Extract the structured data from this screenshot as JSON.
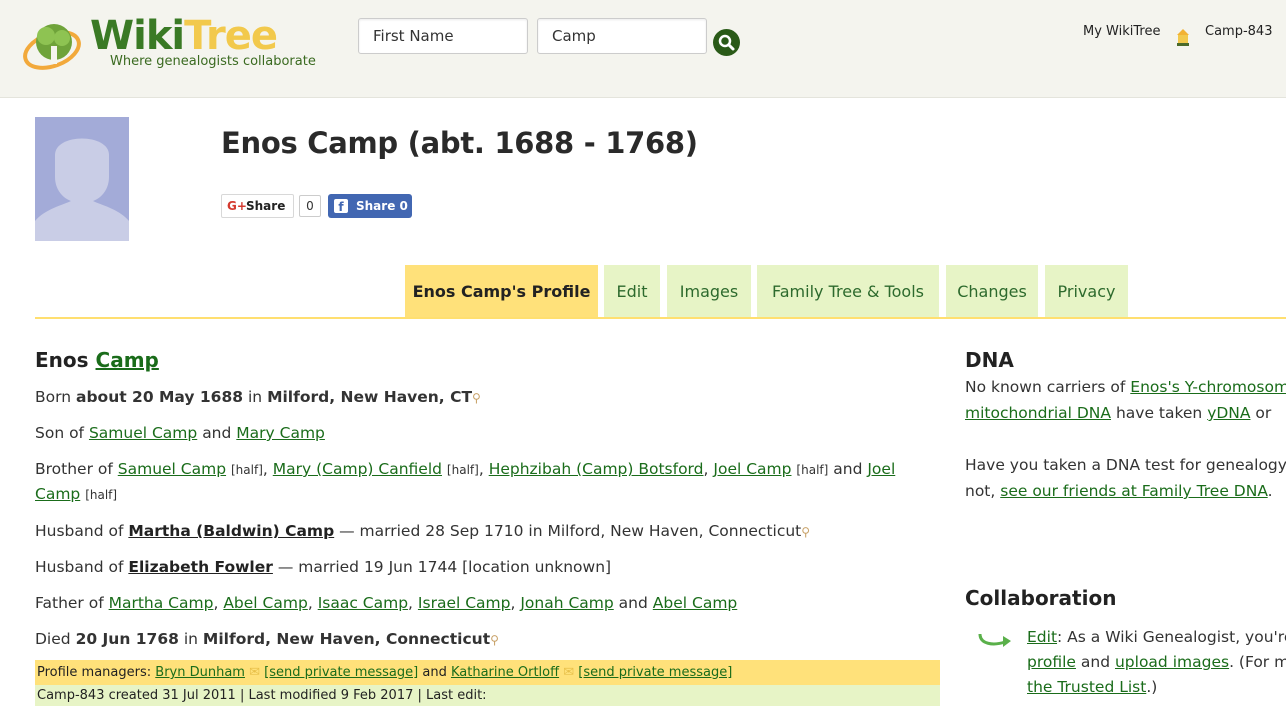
{
  "header": {
    "logo_word_1": "Wiki",
    "logo_word_2": "Tree",
    "logo_tagline": "Where genealogists collaborate",
    "first_name_value": "First Name",
    "last_name_value": "Camp",
    "my_wikitree": "My WikiTree",
    "user_id": "Camp-843"
  },
  "profile": {
    "title": "Enos Camp (abt. 1688 - 1768)",
    "gplus_label": "Share",
    "gplus_icon": "G+",
    "gplus_count": "0",
    "fb_label": "Share 0",
    "fb_icon": "f"
  },
  "tabs": [
    {
      "label": "Enos Camp's Profile",
      "active": true
    },
    {
      "label": "Edit"
    },
    {
      "label": "Images"
    },
    {
      "label": "Family Tree & Tools"
    },
    {
      "label": "Changes"
    },
    {
      "label": "Privacy"
    }
  ],
  "bio": {
    "first_name": "Enos",
    "surname": "Camp",
    "born_prefix": "Born",
    "born_date": "about 20 May 1688",
    "in": "in",
    "born_place": "Milford, New Haven, CT",
    "son_of": "Son of",
    "father": "Samuel Camp",
    "and": "and",
    "mother": "Mary Camp",
    "brother_of": "Brother of",
    "sib1": "Samuel Camp",
    "half": "[half]",
    "comma": ",",
    "sib2": "Mary (Camp) Canfield",
    "sib3": "Hephzibah (Camp) Botsford",
    "sib4": "Joel Camp",
    "sib5a": "Joel",
    "sib5b": "Camp",
    "husband_of": "Husband of",
    "spouse1": "Martha (Baldwin) Camp",
    "marriage1": "— married 28 Sep 1710 in Milford, New Haven, Connecticut",
    "spouse2": "Elizabeth Fowler",
    "marriage2": "— married 19 Jun 1744 [location unknown]",
    "father_of": "Father of",
    "child1": "Martha Camp",
    "child2": "Abel Camp",
    "child3": "Isaac Camp",
    "child4": "Israel Camp",
    "child5": "Jonah Camp",
    "child6": "Abel Camp",
    "died_prefix": "Died",
    "died_date": "20 Jun 1768",
    "died_place": "Milford, New Haven, Connecticut"
  },
  "managers": {
    "label": "Profile managers:",
    "mgr1": "Bryn Dunham",
    "msg": "[send private message]",
    "and": "and",
    "mgr2": "Katharine Ortloff",
    "created": "Camp-843 created 31 Jul 2011 | Last modified 9 Feb 2017 | Last edit:"
  },
  "dna": {
    "heading": "DNA",
    "line1a": "No known carriers of ",
    "line1b": "Enos's Y-chromosome",
    "line2a": "mitochondrial DNA",
    "line2b": " have taken ",
    "line2c": "yDNA",
    "line2d": " or",
    "line3": "Have you taken a DNA test for genealogy",
    "line4a": "not, ",
    "line4b": "see our friends at Family Tree DNA",
    "line4c": "."
  },
  "collab": {
    "heading": "Collaboration",
    "edit": "Edit",
    "line1": ": As a Wiki Genealogist, you're",
    "profile": "profile",
    "line2a": " and ",
    "upload": "upload images",
    "line2b": ". (For m",
    "trusted": "the Trusted List",
    "line3": ".)"
  }
}
